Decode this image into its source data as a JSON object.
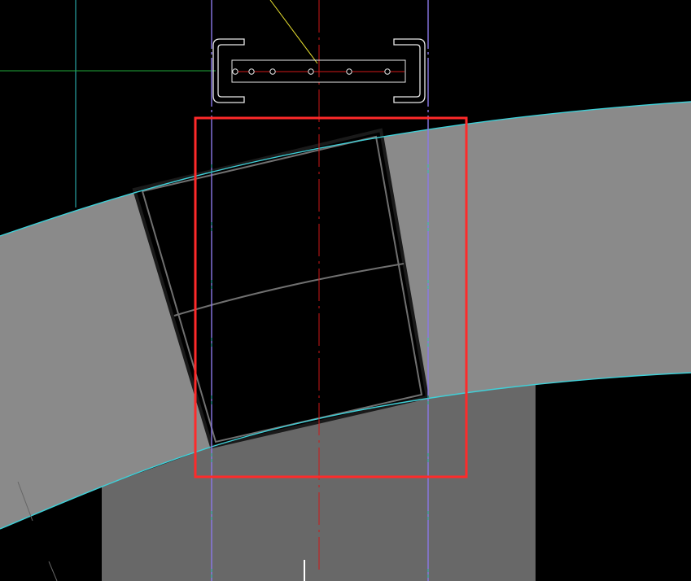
{
  "viewport": {
    "background": "#000000",
    "cursor": "crosshair-cursor"
  },
  "colors": {
    "band_fill": "#8a8a8a",
    "lower_fill": "#686868",
    "band_edge": "#3fd0d8",
    "guide_cyan": "#2fc4c4",
    "guide_violet": "#8a78e8",
    "guide_green": "#1fa83a",
    "axis_red": "#d01818",
    "selection_red": "#ff2a2a",
    "leader_yellow": "#e8e030",
    "outline_white": "#e8e8e8",
    "opening_edge": "#1a1a1a",
    "opening_inner": "#707070",
    "cursor_white": "#ffffff"
  },
  "plate_detail": {
    "hole_count": 6,
    "bracket_count": 2
  },
  "selection": {
    "active": true
  }
}
